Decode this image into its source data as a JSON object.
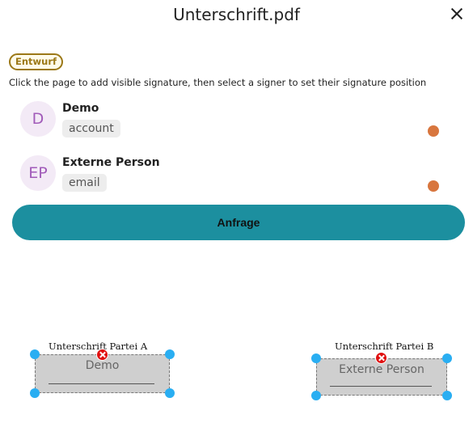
{
  "dialog": {
    "title": "Unterschrift.pdf",
    "close_icon": "close-icon"
  },
  "status_badge": {
    "label": "Entwurf",
    "color": "#9b7817"
  },
  "instruction": "Click the page to add visible signature, then select a signer to set their signature position",
  "signers": [
    {
      "initials": "D",
      "name": "Demo",
      "type": "account",
      "status_color": "#d8763e"
    },
    {
      "initials": "EP",
      "name": "Externe Person",
      "type": "email",
      "status_color": "#d8763e"
    }
  ],
  "request_button": {
    "label": "Anfrage",
    "color": "#1c8f9f"
  },
  "signature_fields": [
    {
      "label": "Unterschrift Partei A",
      "signer": "Demo"
    },
    {
      "label": "Unterschrift Partei B",
      "signer": "Externe Person"
    }
  ],
  "colors": {
    "handle": "#29aef2",
    "remove": "#e01010",
    "field_bg": "#cfcfcf"
  }
}
